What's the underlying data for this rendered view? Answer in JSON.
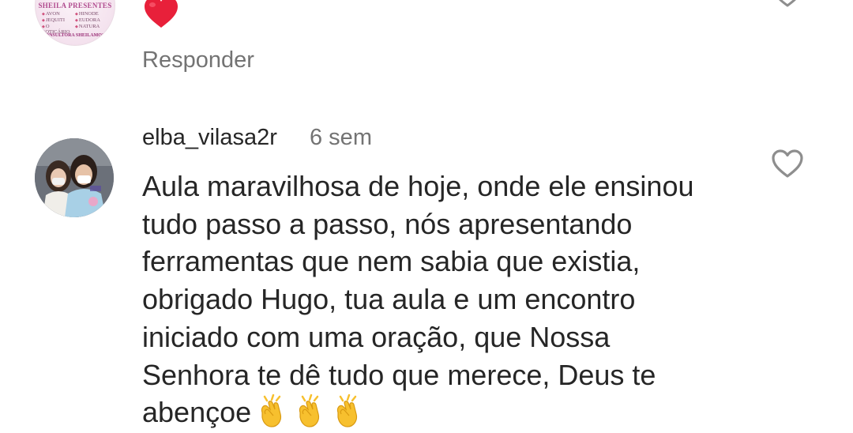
{
  "previous_comment": {
    "avatar_text": {
      "brand": "SHEILA PRESENTES",
      "brands": [
        "AVON",
        "HINODE",
        "JEQUITI",
        "EUDORA",
        "O BOTICÁRIO",
        "NATURA"
      ],
      "footer": "CONSULTORA SHEILAMOSQ"
    },
    "reaction_icon": "red-heart-emoji",
    "reply_label": "Responder",
    "like_icon": "heart-outline-icon"
  },
  "comment": {
    "username": "elba_vilasa2r",
    "time_ago": "6 sem",
    "text": "Aula maravilhosa de hoje, onde ele ensinou\ntudo passo a passo, nós apresentando\nferramentas que nem sabia que existia,\nobrigado Hugo, tua aula e um encontro\niniciado com uma oração, que Nossa\nSenhora te dê tudo que merece, Deus te\nabençoe",
    "emoji_icons": [
      "clapping-hands-emoji",
      "clapping-hands-emoji",
      "clapping-hands-emoji"
    ],
    "like_icon": "heart-outline-icon"
  },
  "colors": {
    "text_primary": "#262626",
    "text_secondary": "#737373",
    "heart_red": "#e8203a",
    "icon_gray": "#8e8e8e",
    "clap_yellow": "#f7c02e"
  }
}
